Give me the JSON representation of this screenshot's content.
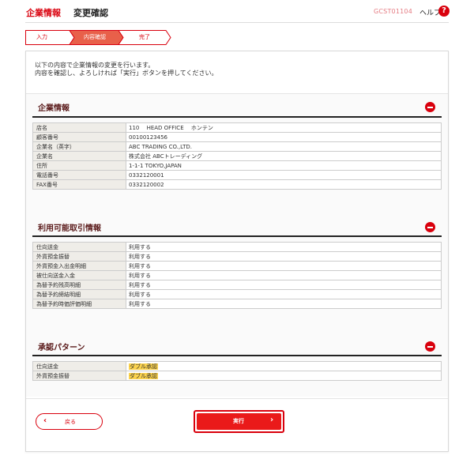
{
  "header": {
    "title": "企業情報",
    "subtitle": "変更確認",
    "screen_id": "GCST01104",
    "help_label": "ヘルプ",
    "help_icon": "?"
  },
  "steps": [
    {
      "label": "入力",
      "state": "done"
    },
    {
      "label": "内容確認",
      "state": "current"
    },
    {
      "label": "完了",
      "state": "todo"
    }
  ],
  "intro": {
    "line1": "以下の内容で企業情報の変更を行います。",
    "line2": "内容を確認し、よろしければ「実行」ボタンを押してください。"
  },
  "sections": {
    "company": {
      "title": "企業情報",
      "rows": [
        {
          "label": "店名",
          "value": "110　 HEAD OFFICE　 ホンテン"
        },
        {
          "label": "顧客番号",
          "value": "00100123456"
        },
        {
          "label": "企業名（英字）",
          "value": "ABC TRADING CO.,LTD."
        },
        {
          "label": "企業名",
          "value": "株式会社 ABCトレーディング"
        },
        {
          "label": "住所",
          "value": "1-1-1 TOKYO,JAPAN"
        },
        {
          "label": "電話番号",
          "value": "0332120001"
        },
        {
          "label": "FAX番号",
          "value": "0332120002"
        }
      ]
    },
    "transactions": {
      "title": "利用可能取引情報",
      "rows": [
        {
          "label": "仕向送金",
          "value": "利用する"
        },
        {
          "label": "外貨預金振替",
          "value": "利用する"
        },
        {
          "label": "外貨預金入出金明細",
          "value": "利用する"
        },
        {
          "label": "被仕向送金入金",
          "value": "利用する"
        },
        {
          "label": "為替予約残高明細",
          "value": "利用する"
        },
        {
          "label": "為替予約締結明細",
          "value": "利用する"
        },
        {
          "label": "為替予約時価評価明細",
          "value": "利用する"
        }
      ]
    },
    "approval": {
      "title": "承認パターン",
      "rows": [
        {
          "label": "仕向送金",
          "value": "ダブル承認"
        },
        {
          "label": "外貨預金振替",
          "value": "ダブル承認"
        }
      ]
    }
  },
  "buttons": {
    "back": "戻る",
    "execute": "実行"
  },
  "colors": {
    "accent": "#d9000d",
    "step_current": "#e8604a",
    "highlight": "#fcd34d"
  }
}
